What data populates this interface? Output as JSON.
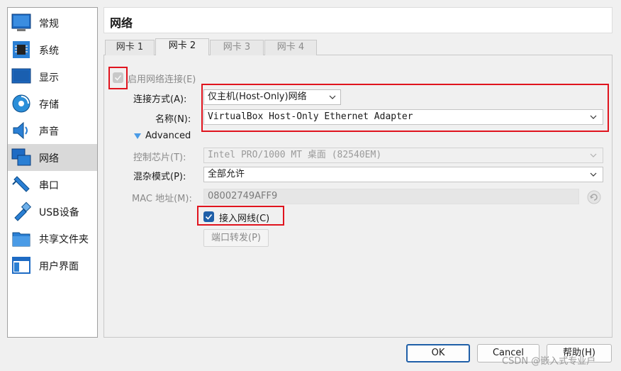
{
  "sidebar": {
    "items": [
      {
        "label": "常规",
        "icon": "general-icon"
      },
      {
        "label": "系统",
        "icon": "chip-icon"
      },
      {
        "label": "显示",
        "icon": "monitor-icon"
      },
      {
        "label": "存储",
        "icon": "disk-icon"
      },
      {
        "label": "声音",
        "icon": "speaker-icon"
      },
      {
        "label": "网络",
        "icon": "network-icon",
        "active": true
      },
      {
        "label": "串口",
        "icon": "serial-port-icon"
      },
      {
        "label": "USB设备",
        "icon": "usb-icon"
      },
      {
        "label": "共享文件夹",
        "icon": "folder-icon"
      },
      {
        "label": "用户界面",
        "icon": "user-interface-icon"
      }
    ]
  },
  "header": {
    "title": "网络"
  },
  "tabs": [
    {
      "label": "网卡 1",
      "active": false
    },
    {
      "label": "网卡 2",
      "active": true
    },
    {
      "label": "网卡 3",
      "active": false
    },
    {
      "label": "网卡 4",
      "active": false
    }
  ],
  "adapter": {
    "enable_label": "启用网络连接(E)",
    "attached_to_label": "连接方式(A):",
    "attached_to_value": "仅主机(Host-Only)网络",
    "name_label": "名称(N):",
    "name_value": "VirtualBox Host-Only Ethernet Adapter",
    "advanced_label": "Advanced",
    "adapter_type_label": "控制芯片(T):",
    "adapter_type_value": "Intel PRO/1000 MT 桌面 (82540EM)",
    "promiscuous_label": "混杂模式(P):",
    "promiscuous_value": "全部允许",
    "mac_label": "MAC 地址(M):",
    "mac_value": "08002749AFF9",
    "cable_label": "接入网线(C)",
    "cable_checked": true,
    "port_forward_label": "端口转发(P)"
  },
  "footer": {
    "ok_label": "OK",
    "cancel_label": "Cancel",
    "help_label": "帮助(H)"
  },
  "watermark": "CSDN @嵌入式专业户",
  "colors": {
    "accent": "#1f5fa8",
    "highlight": "#e0141e",
    "active_item": "#d9d9d9"
  }
}
